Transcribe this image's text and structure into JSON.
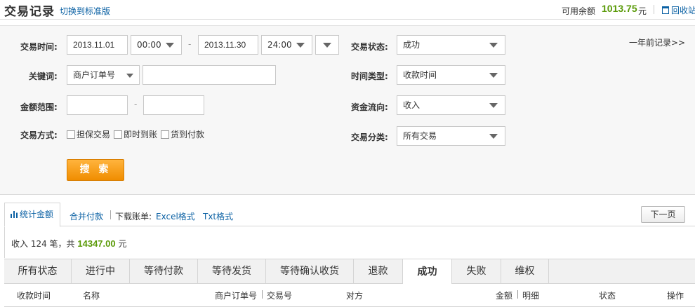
{
  "header": {
    "title": "交易记录",
    "switch_link": "切换到标准版",
    "balance_label": "可用余额",
    "balance_value": "1013.75",
    "balance_unit": "元",
    "recycle_link": "回收站"
  },
  "filters": {
    "time_label": "交易时间:",
    "start_date": "2013.11.01",
    "start_time": "00:00",
    "end_date": "2013.11.30",
    "end_time": "24:00",
    "date_separator": "-",
    "keyword_label": "关键词:",
    "keyword_type": "商户订单号",
    "keyword_value": "",
    "amount_label": "金额范围:",
    "amount_min": "",
    "amount_max": "",
    "trade_mode_label": "交易方式:",
    "trade_modes": [
      "担保交易",
      "即时到账",
      "货到付款"
    ],
    "status_label": "交易状态:",
    "status_value": "成功",
    "time_type_label": "时间类型:",
    "time_type_value": "收款时间",
    "fund_flow_label": "资金流向:",
    "fund_flow_value": "收入",
    "category_label": "交易分类:",
    "category_value": "所有交易",
    "search_button": "搜 索",
    "year_ago_link": "一年前记录>>"
  },
  "summary": {
    "stats_tab": "统计金额",
    "merge_tab": "合并付款",
    "download_label": "下载账单:",
    "excel_link": "Excel格式",
    "txt_link": "Txt格式",
    "next_page": "下一页",
    "text_prefix": "收入 124 笔，共",
    "total": "14347.00",
    "text_suffix": "元"
  },
  "status_tabs": [
    "所有状态",
    "进行中",
    "等待付款",
    "等待发货",
    "等待确认收货",
    "退款",
    "成功",
    "失败",
    "维权"
  ],
  "active_status_tab": "成功",
  "table_headers": [
    "收款时间",
    "名称",
    "商户订单号",
    "交易号",
    "对方",
    "金额",
    "明细",
    "状态",
    "操作"
  ]
}
